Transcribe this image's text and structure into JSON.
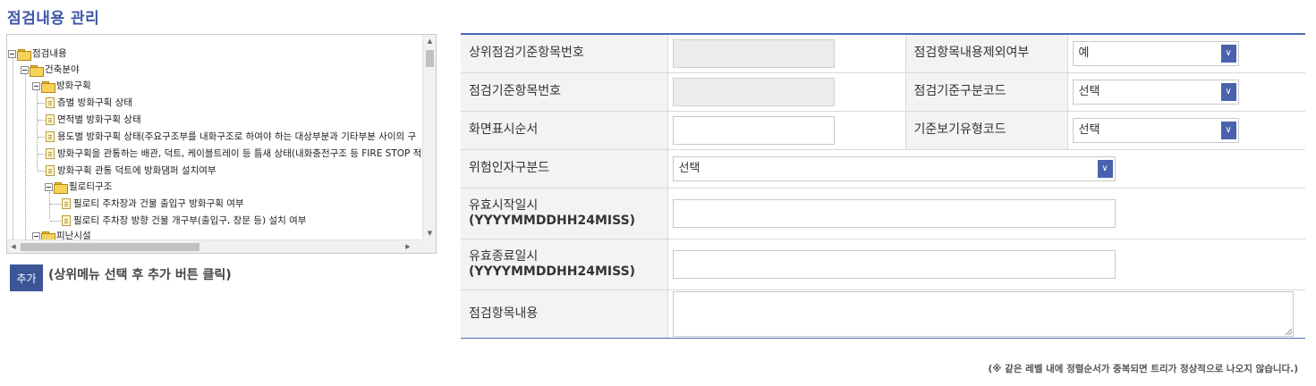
{
  "page": {
    "title": "점검내용 관리"
  },
  "tree": {
    "items": [
      {
        "label": "점검내용"
      },
      {
        "label": "건축분야"
      },
      {
        "label": "방화구획"
      },
      {
        "label": "층별 방화구획 상태"
      },
      {
        "label": "면적별 방화구획 상태"
      },
      {
        "label": "용도별 방화구획 상태(주요구조부를 내화구조로 하여야 하는 대상부분과 기타부분 사이의 구"
      },
      {
        "label": "방화구획을 관통하는 배관, 덕트, 케이블트레이 등 틈새 상태(내화충전구조 등 FIRE STOP 적정"
      },
      {
        "label": "방화구획 관통 덕트에 방화댐퍼 설치여부"
      },
      {
        "label": "필로티구조"
      },
      {
        "label": "필로티 주차장과 건물 출입구 방화구획 여부"
      },
      {
        "label": "필로티 주차장 방향 건물 개구부(출입구, 창문 등) 설치 여부"
      },
      {
        "label": "피난시설"
      }
    ]
  },
  "actions": {
    "add_label": "추가",
    "add_hint": "(상위메뉴 선택 후 추가 버튼 클릭)"
  },
  "form": {
    "parent_no_label": "상위점검기준항목번호",
    "exclude_label": "점검항목내용제외여부",
    "exclude_value": "예",
    "std_no_label": "점검기준항목번호",
    "std_code_label": "점검기준구분코드",
    "std_code_value": "선택",
    "order_label": "화면표시순서",
    "view_type_label": "기준보기유형코드",
    "view_type_value": "선택",
    "hazard_label": "위험인자구분드",
    "hazard_value": "선택",
    "start_label": "유효시작일시",
    "start_format": "(YYYYMMDDHH24MISS)",
    "end_label": "유효종료일시",
    "end_format": "(YYYYMMDDHH24MISS)",
    "content_label": "점검항목내용"
  },
  "footnote": "(※ 같은 레벨 내에 정렬순서가 중복되면 트리가 정상적으로 나오지 않습니다.)"
}
